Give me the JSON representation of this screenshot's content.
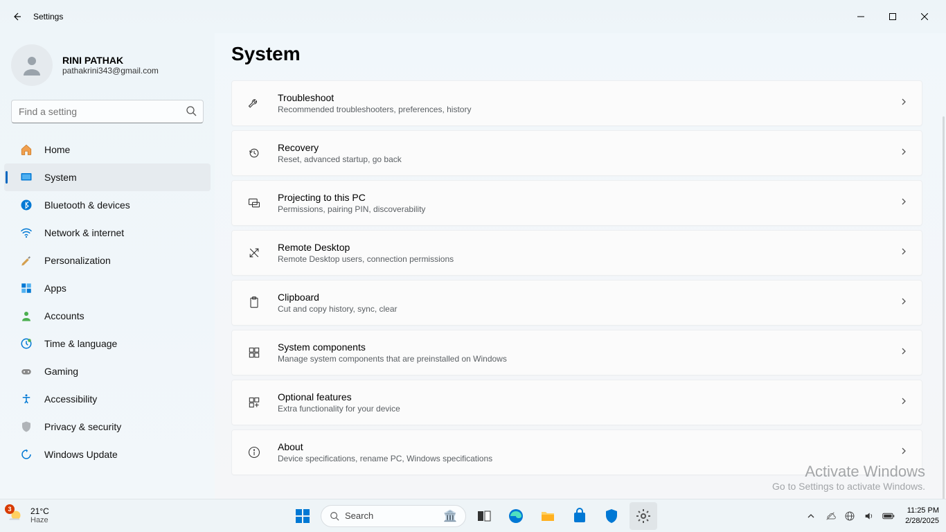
{
  "window": {
    "title": "Settings"
  },
  "profile": {
    "name": "RINI PATHAK",
    "email": "pathakrini343@gmail.com"
  },
  "search": {
    "placeholder": "Find a setting"
  },
  "nav": [
    {
      "label": "Home",
      "icon": "home"
    },
    {
      "label": "System",
      "icon": "system",
      "active": true
    },
    {
      "label": "Bluetooth & devices",
      "icon": "bluetooth"
    },
    {
      "label": "Network & internet",
      "icon": "wifi"
    },
    {
      "label": "Personalization",
      "icon": "brush"
    },
    {
      "label": "Apps",
      "icon": "apps"
    },
    {
      "label": "Accounts",
      "icon": "person"
    },
    {
      "label": "Time & language",
      "icon": "clock"
    },
    {
      "label": "Gaming",
      "icon": "gamepad"
    },
    {
      "label": "Accessibility",
      "icon": "accessibility"
    },
    {
      "label": "Privacy & security",
      "icon": "shield"
    },
    {
      "label": "Windows Update",
      "icon": "update"
    }
  ],
  "page": {
    "title": "System"
  },
  "cards": [
    {
      "title": "Troubleshoot",
      "sub": "Recommended troubleshooters, preferences, history",
      "icon": "wrench"
    },
    {
      "title": "Recovery",
      "sub": "Reset, advanced startup, go back",
      "icon": "recovery"
    },
    {
      "title": "Projecting to this PC",
      "sub": "Permissions, pairing PIN, discoverability",
      "icon": "project"
    },
    {
      "title": "Remote Desktop",
      "sub": "Remote Desktop users, connection permissions",
      "icon": "remote"
    },
    {
      "title": "Clipboard",
      "sub": "Cut and copy history, sync, clear",
      "icon": "clipboard"
    },
    {
      "title": "System components",
      "sub": "Manage system components that are preinstalled on Windows",
      "icon": "components"
    },
    {
      "title": "Optional features",
      "sub": "Extra functionality for your device",
      "icon": "optional"
    },
    {
      "title": "About",
      "sub": "Device specifications, rename PC, Windows specifications",
      "icon": "info"
    }
  ],
  "watermark": {
    "line1": "Activate Windows",
    "line2": "Go to Settings to activate Windows."
  },
  "taskbar": {
    "weather": {
      "temp": "21°C",
      "cond": "Haze",
      "badge": "3"
    },
    "search_placeholder": "Search",
    "clock": {
      "time": "11:25 PM",
      "date": "2/28/2025"
    }
  }
}
